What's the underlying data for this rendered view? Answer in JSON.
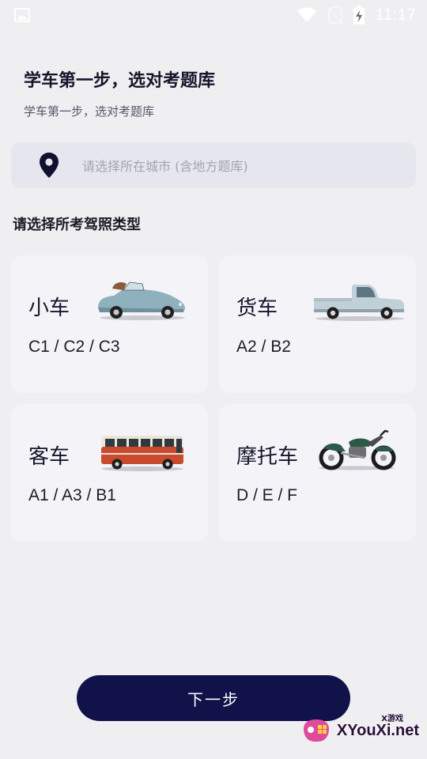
{
  "status_bar": {
    "time": "11:17",
    "icons": [
      "image-icon",
      "wifi-icon",
      "no-sim-icon",
      "battery-charging-icon"
    ]
  },
  "header": {
    "title": "学车第一步，选对考题库",
    "subtitle": "学车第一步，选对考题库"
  },
  "city_select": {
    "icon": "location-pin-icon",
    "placeholder": "请选择所在城市 (含地方题库)"
  },
  "license_section": {
    "label": "请选择所考驾照类型",
    "cards": [
      {
        "name": "小车",
        "codes": "C1 / C2 / C3",
        "icon": "convertible-car-icon"
      },
      {
        "name": "货车",
        "codes": "A2 / B2",
        "icon": "pickup-truck-icon"
      },
      {
        "name": "客车",
        "codes": "A1 / A3 / B1",
        "icon": "bus-icon"
      },
      {
        "name": "摩托车",
        "codes": "D / E / F",
        "icon": "motorcycle-icon"
      }
    ]
  },
  "footer": {
    "next_label": "下一步"
  },
  "watermark": {
    "text": "XYouXi.net",
    "small": "X游戏"
  },
  "colors": {
    "background": "#efeff1",
    "card": "#f4f4f8",
    "field": "#e6e6ee",
    "button": "#11124a"
  }
}
